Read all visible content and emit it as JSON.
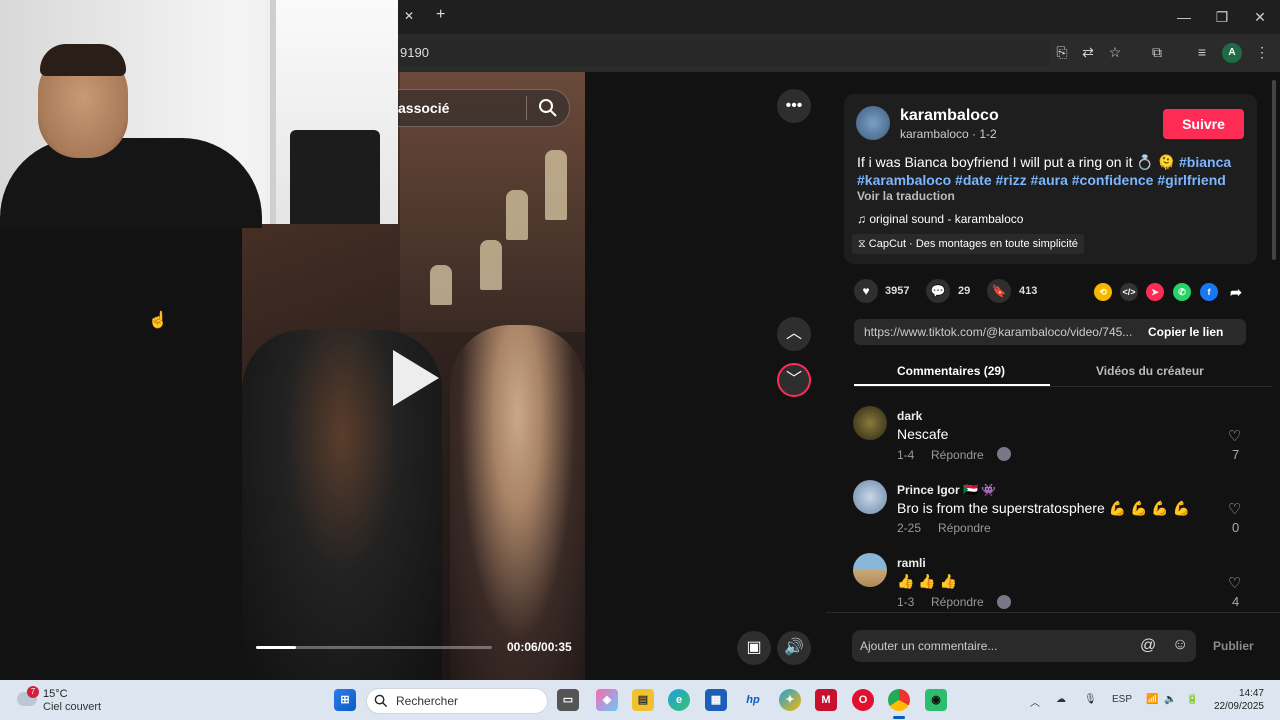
{
  "browser": {
    "url_fragment": "9190",
    "close_tab": "✕",
    "new_tab": "+",
    "profile_initial": "A"
  },
  "video": {
    "search_text": "associé",
    "time": "00:06/00:35",
    "progress": 0.17
  },
  "post": {
    "username": "karambaloco",
    "handle_meta": "karambaloco · 1-2",
    "follow_label": "Suivre",
    "desc_text": "If i was Bianca boyfriend I will put a ring on it 💍 🫠 ",
    "hashtags_line1": "#bianca",
    "hashtags_line2": "#karambaloco #date #rizz #aura #confidence #girlfriend",
    "translate": "Voir la traduction",
    "sound": "original sound - karambaloco",
    "capcut": "CapCut · Des montages en toute simplicité",
    "likes": "3957",
    "comments": "29",
    "saves": "413",
    "link": "https://www.tiktok.com/@karambaloco/video/745...",
    "copy_label": "Copier le lien"
  },
  "tabs": {
    "comments": "Commentaires (29)",
    "creator_videos": "Vidéos du créateur"
  },
  "comments": [
    {
      "name": "dark",
      "text": "Nescafe",
      "date": "1-4",
      "reply": "Répondre",
      "likes": "7"
    },
    {
      "name": "Prince Igor 🇸🇩 👾",
      "text": "Bro is from the superstratosphere 💪 💪 💪 💪",
      "date": "2-25",
      "reply": "Répondre",
      "likes": "0"
    },
    {
      "name": "ramli",
      "text": "👍 👍 👍",
      "date": "1-3",
      "reply": "Répondre",
      "likes": "4"
    }
  ],
  "comment_box": {
    "placeholder": "Ajouter un commentaire...",
    "publish": "Publier"
  },
  "taskbar": {
    "weather_temp": "15°C",
    "weather_desc": "Ciel couvert",
    "weather_badge": "7",
    "search": "Rechercher",
    "lang": "ESP",
    "time": "14:47",
    "date": "22/09/2025"
  },
  "colors": {
    "accent": "#fe2c55",
    "hashtag": "#7bb6ff"
  }
}
